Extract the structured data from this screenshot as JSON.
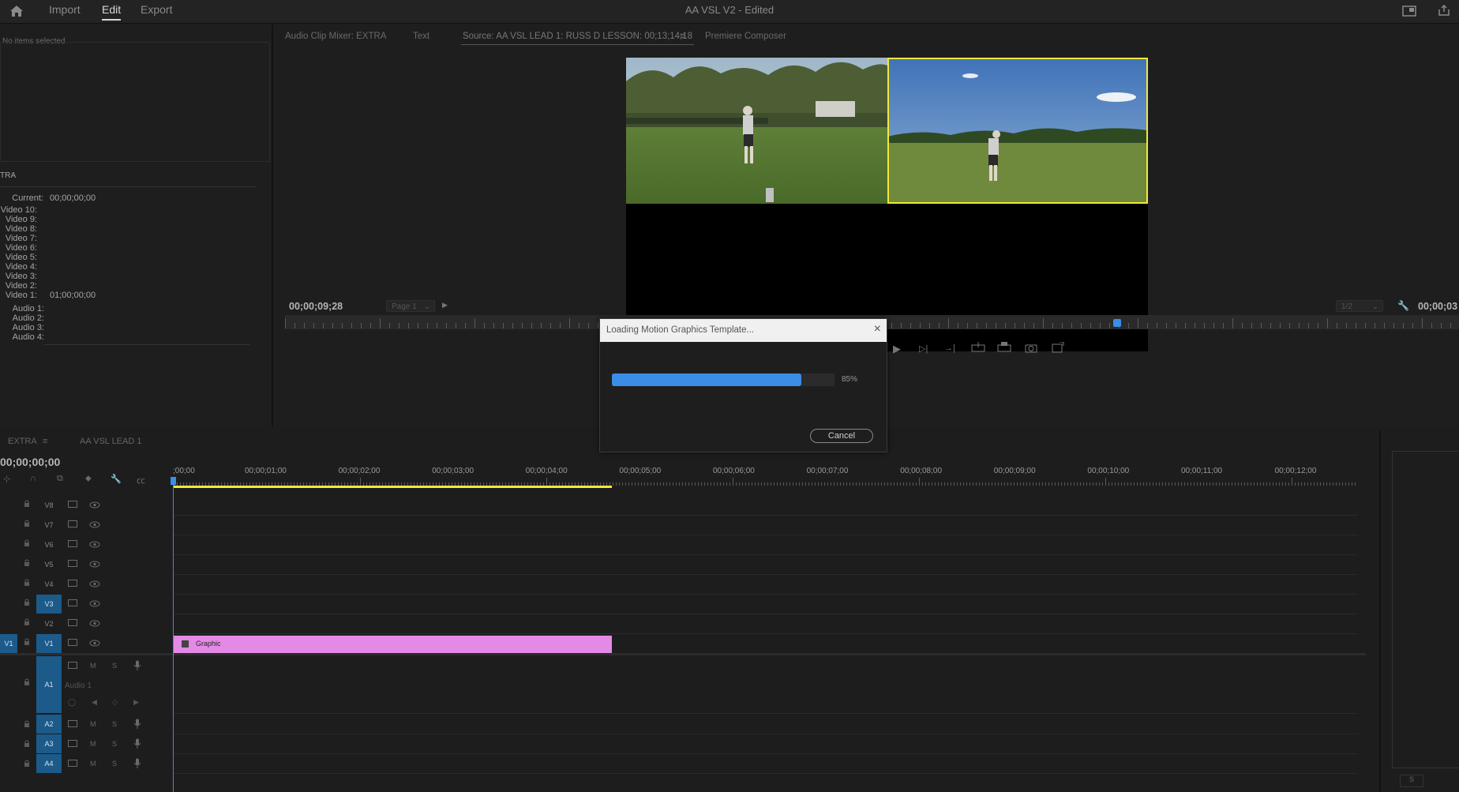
{
  "app": {
    "title": "AA VSL V2 - Edited",
    "tabs": [
      "Import",
      "Edit",
      "Export"
    ],
    "active_tab": "Edit"
  },
  "left_panel": {
    "empty_text": "No items selected",
    "section_label": "TRA",
    "current_label": "Current:",
    "current_value": "00;00;00;00",
    "video_rows": [
      {
        "label": "Video 10:",
        "value": ""
      },
      {
        "label": "Video 9:",
        "value": ""
      },
      {
        "label": "Video 8:",
        "value": ""
      },
      {
        "label": "Video 7:",
        "value": ""
      },
      {
        "label": "Video 6:",
        "value": ""
      },
      {
        "label": "Video 5:",
        "value": ""
      },
      {
        "label": "Video 4:",
        "value": ""
      },
      {
        "label": "Video 3:",
        "value": ""
      },
      {
        "label": "Video 2:",
        "value": ""
      },
      {
        "label": "Video 1:",
        "value": "01;00;00;00"
      }
    ],
    "audio_rows": [
      "Audio 1:",
      "Audio 2:",
      "Audio 3:",
      "Audio 4:"
    ]
  },
  "source_panel": {
    "tabs": [
      "Audio Clip Mixer: EXTRA",
      "Text",
      "Source: AA VSL LEAD 1: RUSS D LESSON: 00;13;14;18",
      "Premiere Composer"
    ],
    "active_tab_index": 2,
    "timecode": "00;00;09;28",
    "page_select": "Page 1",
    "zoom_select": "1/2",
    "right_timecode": "00;00;03"
  },
  "dialog": {
    "title": "Loading Motion Graphics Template...",
    "progress": 0.85,
    "progress_label": "85%",
    "cancel_label": "Cancel"
  },
  "timeline": {
    "tabs": [
      "EXTRA",
      "AA VSL LEAD 1"
    ],
    "timecode": "00;00;00;00",
    "ruler_labels": [
      ";00;00",
      "00;00;01;00",
      "00;00;02;00",
      "00;00;03;00",
      "00;00;04;00",
      "00;00;05;00",
      "00;00;06;00",
      "00;00;07;00",
      "00;00;08;00",
      "00;00;09;00",
      "00;00;10;00",
      "00;00;11;00",
      "00;00;12;00"
    ],
    "video_tracks": [
      {
        "name": "V8",
        "targeted": false
      },
      {
        "name": "V7",
        "targeted": false
      },
      {
        "name": "V6",
        "targeted": false
      },
      {
        "name": "V5",
        "targeted": false
      },
      {
        "name": "V4",
        "targeted": false
      },
      {
        "name": "V3",
        "targeted": true
      },
      {
        "name": "V2",
        "targeted": false
      },
      {
        "name": "V1",
        "targeted": true
      }
    ],
    "source_patch": "V1",
    "audio_tracks": [
      {
        "name": "A1",
        "label": "Audio 1"
      },
      {
        "name": "A2",
        "label": ""
      },
      {
        "name": "A3",
        "label": ""
      },
      {
        "name": "A4",
        "label": ""
      }
    ],
    "clip": {
      "name": "Graphic",
      "color": "#e48ae6"
    }
  },
  "right_panel": {
    "button_label": "S"
  },
  "colors": {
    "accent": "#3a8ee6",
    "selection_outline": "#f2e83a",
    "track_target": "#1c5a8a"
  }
}
